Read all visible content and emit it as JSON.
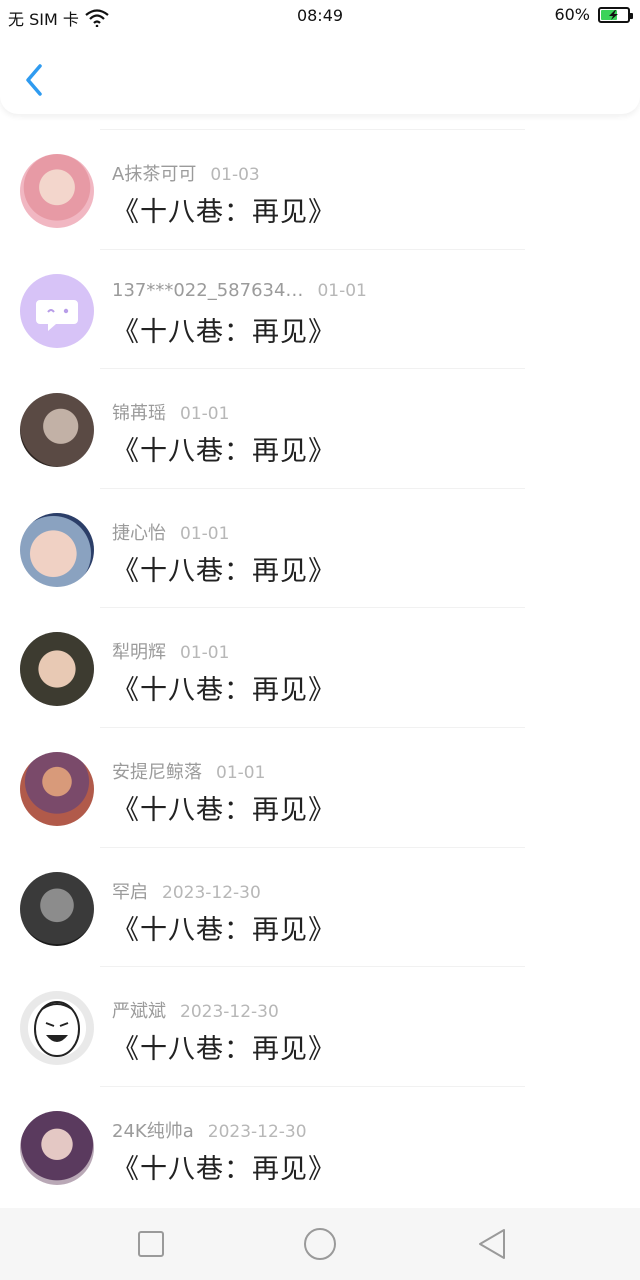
{
  "status_bar": {
    "carrier": "无 SIM 卡",
    "time": "08:49",
    "battery": "60%",
    "battery_level": 0.6
  },
  "header": {
    "back_icon": "chevron-left-icon",
    "accent_color": "#2f9bf0"
  },
  "comments": [
    {
      "user": "A抹茶可可",
      "date": "01-03",
      "text": "《十八巷：再见》",
      "avatar": "avatar-photo"
    },
    {
      "user": "137***022_587634…",
      "date": "01-01",
      "text": "《十八巷：再见》",
      "avatar": "default-chat-bubble-avatar"
    },
    {
      "user": "锦苒瑶",
      "date": "01-01",
      "text": "《十八巷：再见》",
      "avatar": "avatar-photo"
    },
    {
      "user": "捷心怡",
      "date": "01-01",
      "text": "《十八巷：再见》",
      "avatar": "avatar-photo"
    },
    {
      "user": "犁明辉",
      "date": "01-01",
      "text": "《十八巷：再见》",
      "avatar": "avatar-photo"
    },
    {
      "user": "安提尼鲸落",
      "date": "01-01",
      "text": "《十八巷：再见》",
      "avatar": "avatar-photo"
    },
    {
      "user": "罕启",
      "date": "2023-12-30",
      "text": "《十八巷：再见》",
      "avatar": "avatar-photo"
    },
    {
      "user": "严斌斌",
      "date": "2023-12-30",
      "text": "《十八巷：再见》",
      "avatar": "avatar-meme-face"
    },
    {
      "user": "24K纯帅a",
      "date": "2023-12-30",
      "text": "《十八巷：再见》",
      "avatar": "avatar-photo"
    }
  ],
  "nav_bar": {
    "icons": [
      "recent-apps-icon",
      "home-icon",
      "back-icon"
    ]
  }
}
